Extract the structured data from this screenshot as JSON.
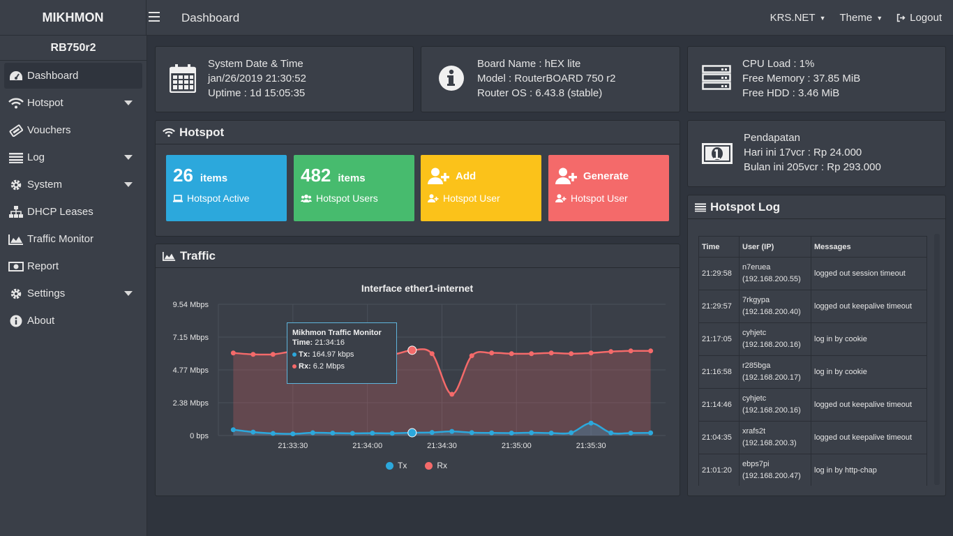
{
  "header": {
    "brand": "MIKHMON",
    "page_title": "Dashboard",
    "session": "KRS.NET",
    "theme_label": "Theme",
    "logout_label": "Logout"
  },
  "sidebar": {
    "router_name": "RB750r2",
    "items": [
      {
        "label": "Dashboard",
        "icon": "dashboard-icon",
        "dropdown": false
      },
      {
        "label": "Hotspot",
        "icon": "wifi-icon",
        "dropdown": true
      },
      {
        "label": "Vouchers",
        "icon": "ticket-icon",
        "dropdown": false
      },
      {
        "label": "Log",
        "icon": "list-icon",
        "dropdown": true
      },
      {
        "label": "System",
        "icon": "gear-icon",
        "dropdown": true
      },
      {
        "label": "DHCP Leases",
        "icon": "sitemap-icon",
        "dropdown": false
      },
      {
        "label": "Traffic Monitor",
        "icon": "area-chart-icon",
        "dropdown": false
      },
      {
        "label": "Report",
        "icon": "money-icon",
        "dropdown": false
      },
      {
        "label": "Settings",
        "icon": "gear-icon",
        "dropdown": true
      },
      {
        "label": "About",
        "icon": "info-icon",
        "dropdown": false
      }
    ]
  },
  "system_card": {
    "line1": "System Date & Time",
    "line2": "jan/26/2019 21:30:52",
    "line3": "Uptime : 1d 15:05:35"
  },
  "board_card": {
    "line1": "Board Name : hEX lite",
    "line2": "Model : RouterBOARD 750 r2",
    "line3": "Router OS : 6.43.8 (stable)"
  },
  "resource_card": {
    "line1": "CPU Load : 1%",
    "line2": "Free Memory : 37.85 MiB",
    "line3": "Free HDD : 3.46 MiB"
  },
  "income_card": {
    "line1": "Pendapatan",
    "line2": "Hari ini 17vcr : Rp 24.000",
    "line3": "Bulan ini 205vcr : Rp 293.000"
  },
  "hotspot": {
    "title": "Hotspot",
    "tiles": [
      {
        "num": "26",
        "unit": "items",
        "label": "Hotspot Active",
        "color": "#2ca8dc"
      },
      {
        "num": "482",
        "unit": "items",
        "label": "Hotspot Users",
        "color": "#47bb6e"
      },
      {
        "head": "Add",
        "label": "Hotspot User",
        "color": "#fbc21a"
      },
      {
        "head": "Generate",
        "label": "Hotspot User",
        "color": "#f46a6a"
      }
    ]
  },
  "traffic": {
    "title": "Traffic",
    "tooltip": {
      "title": "Mikhmon Traffic Monitor",
      "time_label": "Time:",
      "time_value": "21:34:16",
      "tx_label": "Tx:",
      "tx_value": "164.97 kbps",
      "rx_label": "Rx:",
      "rx_value": "6.2 Mbps"
    }
  },
  "chart_data": {
    "type": "area",
    "title": "Interface ether1-internet",
    "y_ticks": [
      "0 bps",
      "2.38 Mbps",
      "4.77 Mbps",
      "7.15 Mbps",
      "9.54 Mbps"
    ],
    "ylim": [
      0,
      9.54
    ],
    "x_ticks": [
      "21:33:30",
      "21:34:00",
      "21:34:30",
      "21:35:00",
      "21:35:30"
    ],
    "x_tick_seconds": [
      30,
      60,
      90,
      120,
      150
    ],
    "x_seconds": [
      6,
      14,
      22,
      30,
      38,
      46,
      54,
      62,
      70,
      78,
      86,
      94,
      102,
      110,
      118,
      126,
      134,
      142,
      150,
      158,
      166,
      174
    ],
    "series": [
      {
        "name": "Tx",
        "color": "#2ca8dc",
        "values": [
          0.42,
          0.25,
          0.15,
          0.12,
          0.2,
          0.18,
          0.16,
          0.17,
          0.16,
          0.2,
          0.22,
          0.3,
          0.21,
          0.19,
          0.18,
          0.2,
          0.18,
          0.2,
          0.9,
          0.19,
          0.18,
          0.19
        ]
      },
      {
        "name": "Rx",
        "color": "#f46a6a",
        "values": [
          6.0,
          5.9,
          5.9,
          6.1,
          6.0,
          5.85,
          5.85,
          6.2,
          5.9,
          6.2,
          5.95,
          3.0,
          5.8,
          6.0,
          5.95,
          5.95,
          6.0,
          5.95,
          6.0,
          6.1,
          6.15,
          6.15
        ]
      }
    ],
    "legend": [
      "Tx",
      "Rx"
    ],
    "legend_position": "bottom",
    "grid": true
  },
  "log": {
    "title": "Hotspot Log",
    "columns": [
      "Time",
      "User (IP)",
      "Messages"
    ],
    "rows": [
      {
        "time": "21:29:58",
        "user": "n7eruea",
        "ip": "(192.168.200.55)",
        "msg": "logged out session timeout"
      },
      {
        "time": "21:29:57",
        "user": "7rkgypa",
        "ip": "(192.168.200.40)",
        "msg": "logged out keepalive timeout"
      },
      {
        "time": "21:17:05",
        "user": "cyhjetc",
        "ip": "(192.168.200.16)",
        "msg": "log in by cookie"
      },
      {
        "time": "21:16:58",
        "user": "r285bga",
        "ip": "(192.168.200.17)",
        "msg": "log in by cookie"
      },
      {
        "time": "21:14:46",
        "user": "cyhjetc",
        "ip": "(192.168.200.16)",
        "msg": "logged out keepalive timeout"
      },
      {
        "time": "21:04:35",
        "user": "xrafs2t",
        "ip": "(192.168.200.3)",
        "msg": "logged out keepalive timeout"
      },
      {
        "time": "21:01:20",
        "user": "ebps7pi",
        "ip": "(192.168.200.47)",
        "msg": "log in by http-chap"
      }
    ]
  }
}
